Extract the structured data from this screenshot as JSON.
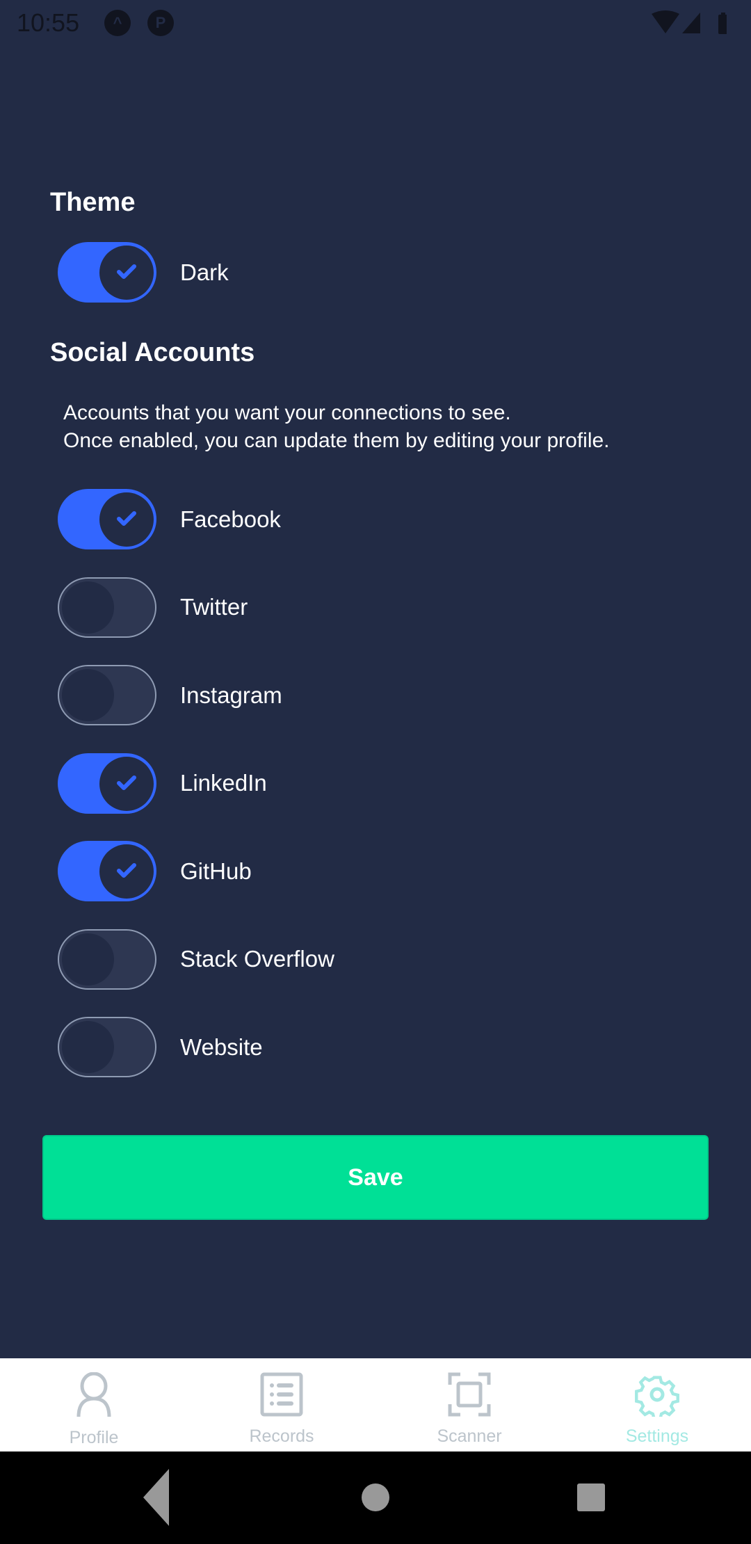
{
  "status_bar": {
    "time": "10:55",
    "icons": [
      "notification-a-icon",
      "notification-p-icon",
      "wifi-icon",
      "signal-icon",
      "battery-icon"
    ]
  },
  "theme": {
    "heading": "Theme",
    "toggle": {
      "label": "Dark",
      "on": true
    }
  },
  "social": {
    "heading": "Social Accounts",
    "description_line1": "Accounts that you want your connections to see.",
    "description_line2": "Once enabled, you can update them by editing your profile.",
    "accounts": [
      {
        "label": "Facebook",
        "on": true
      },
      {
        "label": "Twitter",
        "on": false
      },
      {
        "label": "Instagram",
        "on": false
      },
      {
        "label": "LinkedIn",
        "on": true
      },
      {
        "label": "GitHub",
        "on": true
      },
      {
        "label": "Stack Overflow",
        "on": false
      },
      {
        "label": "Website",
        "on": false
      }
    ]
  },
  "save_label": "Save",
  "nav": {
    "items": [
      {
        "label": "Profile",
        "icon": "person-icon"
      },
      {
        "label": "Records",
        "icon": "list-icon"
      },
      {
        "label": "Scanner",
        "icon": "scan-icon"
      },
      {
        "label": "Settings",
        "icon": "gear-icon",
        "active": true
      }
    ]
  },
  "colors": {
    "background": "#222B45",
    "accent": "#3366FF",
    "save": "#00E096",
    "nav_active": "#A3E9E3",
    "nav_inactive": "#BCC4CB"
  }
}
